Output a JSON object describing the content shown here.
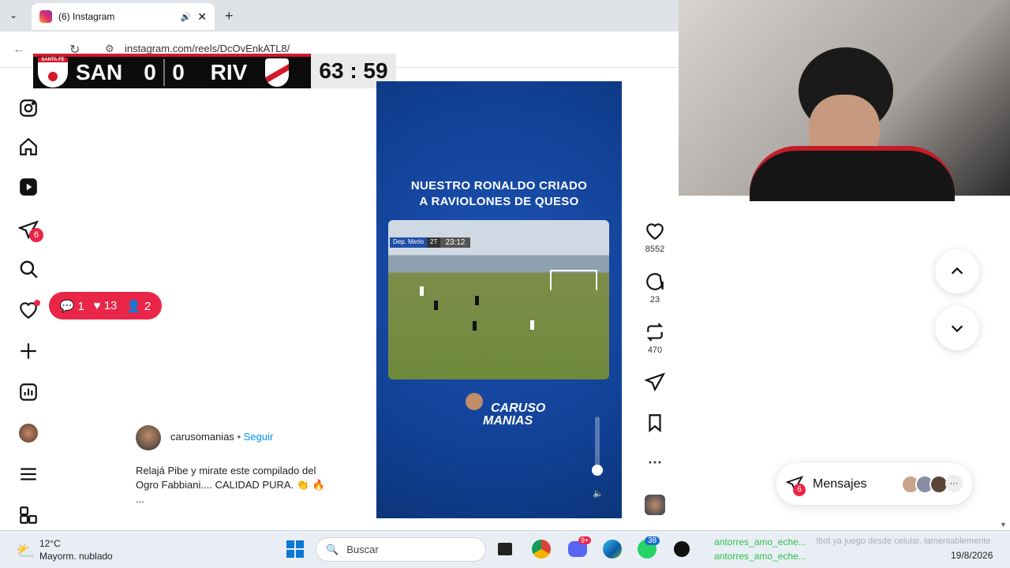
{
  "browser": {
    "tab_title": "(6) Instagram",
    "url": "instagram.com/reels/DcOvEnkATL8/"
  },
  "scoreboard": {
    "home_badge": "SANTA FE",
    "home": "SAN",
    "home_score": "0",
    "away_score": "0",
    "away": "RIV",
    "clock": "63 : 59"
  },
  "sidebar": {
    "notifications_count": "6"
  },
  "notifications_pill": {
    "comments": "1",
    "likes": "13",
    "follows": "2"
  },
  "reel": {
    "title_line1": "NUESTRO RONALDO CRIADO",
    "title_line2": "A RAVIOLONES DE QUESO",
    "clip_team": "Dep. Merlo",
    "clip_half": "2T",
    "clip_time": "23:12",
    "brand_line1": "CARUSO",
    "brand_line2": "MANIAS",
    "volume_level": 0.1
  },
  "actions": {
    "likes": "8552",
    "comments": "23",
    "reposts": "470"
  },
  "post": {
    "username": "carusomanias",
    "separator": "•",
    "follow": "Seguir",
    "caption_line1": "Relajá Pibe y mirate este compilado del",
    "caption_line2": "Ogro Fabbiani.... CALIDAD PURA. 👏 🔥",
    "more": "..."
  },
  "messages": {
    "label": "Mensajes",
    "badge": "6",
    "more": "···"
  },
  "taskbar": {
    "weather_temp": "12°C",
    "weather_desc": "Mayorm. nublado",
    "search_placeholder": "Buscar",
    "discord_badge": "9+",
    "whatsapp_badge": "38",
    "chat_line1": "antorres_amo_eche...",
    "chat_line2": "antorres_amo_eche...",
    "chat_overlay": "!bot ya juego desde celular, lamentablemente",
    "date": "19/8/2026"
  },
  "colors": {
    "accent": "#ea2648",
    "reel_bg": "#1648a4",
    "follow": "#0095f6"
  }
}
